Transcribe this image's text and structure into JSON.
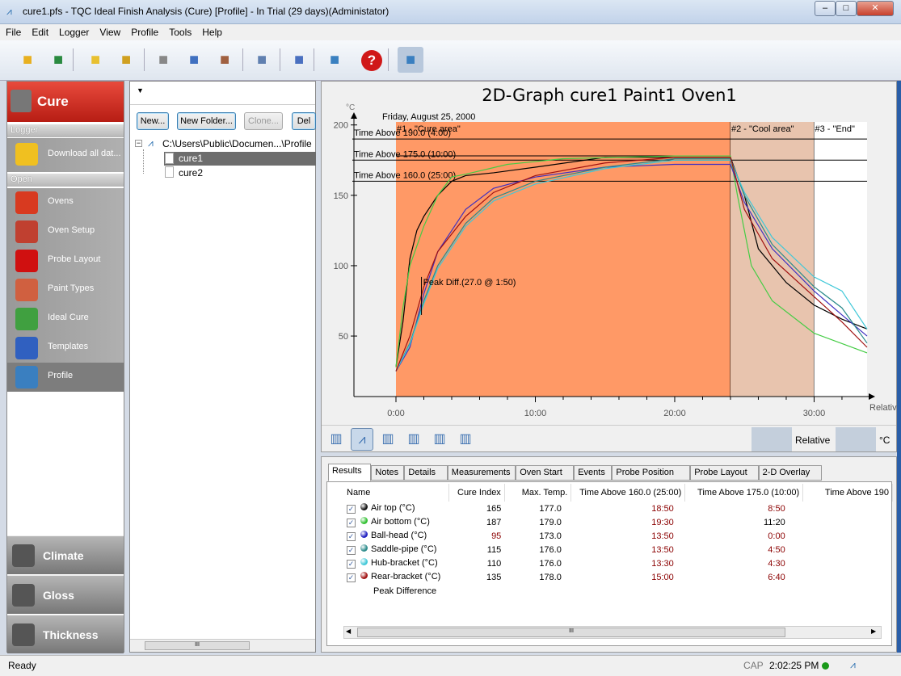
{
  "window": {
    "title": "cure1.pfs - TQC Ideal Finish Analysis (Cure) [Profile]  - In Trial (29 days)(Administator)"
  },
  "menu": [
    "File",
    "Edit",
    "Logger",
    "View",
    "Profile",
    "Tools",
    "Help"
  ],
  "toolbar": [
    "open-folder-icon",
    "export-icon",
    "download-icon",
    "upload-icon",
    "print-icon",
    "print-preview-icon",
    "print-setup-icon",
    "copy-icon",
    "zoom-graph-icon",
    "notes-icon",
    "help-icon",
    "profile-graph-icon"
  ],
  "sidebar": {
    "header": "Cure",
    "logger_label": "Logger",
    "download": "Download all dat...",
    "open_label": "Open",
    "items": [
      {
        "label": "Ovens",
        "color": "#d83a20"
      },
      {
        "label": "Oven Setup",
        "color": "#c04030"
      },
      {
        "label": "Probe Layout",
        "color": "#d01010"
      },
      {
        "label": "Paint Types",
        "color": "#d06040"
      },
      {
        "label": "Ideal Cure",
        "color": "#40a040"
      },
      {
        "label": "Templates",
        "color": "#3060c0"
      },
      {
        "label": "Profile",
        "color": "#3a7fc0"
      }
    ],
    "bottom": [
      "Climate",
      "Gloss",
      "Thickness"
    ]
  },
  "tree": {
    "buttons": [
      "New...",
      "New Folder...",
      "Clone...",
      "Del"
    ],
    "root": "C:\\Users\\Public\\Documen...\\Profile",
    "items": [
      "cure1",
      "cure2"
    ],
    "selected": "cure1",
    "scroll_thumb": "III"
  },
  "graph_toolbar": {
    "icons": [
      "probe-setup-icon",
      "profile-graph-icon",
      "bar-chart-icon",
      "curve-icon",
      "3d-icon",
      "histogram-icon"
    ],
    "mode": "Relative",
    "unit": "°C"
  },
  "chart_data": {
    "type": "line",
    "title": "2D-Graph cure1 Paint1 Oven1",
    "date": "Friday, August 25, 2000",
    "ylabel": "°C",
    "xlabel": "Relative",
    "xlim": [
      0,
      33.8
    ],
    "ylim": [
      7,
      205
    ],
    "xticks": [
      "0:00",
      "10:00",
      "20:00",
      "30:00"
    ],
    "yticks": [
      50,
      100,
      150,
      200
    ],
    "zones": [
      {
        "label": "#1 - \"Cure area\"",
        "from": 0,
        "to": 24,
        "color": "#ff9966"
      },
      {
        "label": "#2 - \"Cool area\"",
        "from": 24,
        "to": 30,
        "color": "#e8c4ae"
      },
      {
        "label": "#3 - \"End\"",
        "from": 30,
        "to": 33.8,
        "color": "#ffffff"
      }
    ],
    "thresholds": [
      {
        "label": "Time Above 190.0 (4:00)",
        "value": 190
      },
      {
        "label": "Time Above 175.0 (10:00)",
        "value": 175
      },
      {
        "label": "Time Above 160.0 (25:00)",
        "value": 160
      }
    ],
    "annotation": {
      "label": "Peak Diff.(27.0 @ 1:50)",
      "x": 1.83,
      "y_low": 65,
      "y_high": 92
    },
    "series": [
      {
        "name": "Air top (°C)",
        "color": "#000000",
        "points": [
          [
            0,
            28
          ],
          [
            0.5,
            60
          ],
          [
            1,
            105
          ],
          [
            1.5,
            125
          ],
          [
            2,
            135
          ],
          [
            3,
            150
          ],
          [
            4,
            160
          ],
          [
            5,
            164
          ],
          [
            7,
            166
          ],
          [
            10,
            170
          ],
          [
            15,
            177
          ],
          [
            20,
            177
          ],
          [
            24,
            177
          ],
          [
            25,
            150
          ],
          [
            26,
            112
          ],
          [
            28,
            88
          ],
          [
            30,
            72
          ],
          [
            32,
            62
          ],
          [
            33.8,
            55
          ]
        ]
      },
      {
        "name": "Air bottom (°C)",
        "color": "#44cc44",
        "points": [
          [
            0,
            28
          ],
          [
            0.5,
            70
          ],
          [
            1,
            100
          ],
          [
            2,
            128
          ],
          [
            3,
            150
          ],
          [
            4,
            163
          ],
          [
            5,
            165
          ],
          [
            8,
            172
          ],
          [
            12,
            176
          ],
          [
            20,
            178
          ],
          [
            24,
            178
          ],
          [
            24.5,
            150
          ],
          [
            25.5,
            100
          ],
          [
            27,
            75
          ],
          [
            30,
            52
          ],
          [
            33.8,
            38
          ]
        ]
      },
      {
        "name": "Ball-head (°C)",
        "color": "#4030c0",
        "points": [
          [
            0,
            25
          ],
          [
            1,
            42
          ],
          [
            2,
            80
          ],
          [
            3,
            110
          ],
          [
            4,
            125
          ],
          [
            5,
            140
          ],
          [
            7,
            155
          ],
          [
            10,
            163
          ],
          [
            15,
            170
          ],
          [
            20,
            172
          ],
          [
            24,
            172
          ],
          [
            25,
            145
          ],
          [
            27,
            112
          ],
          [
            30,
            82
          ],
          [
            32,
            65
          ],
          [
            33.8,
            50
          ]
        ]
      },
      {
        "name": "Saddle-pipe (°C)",
        "color": "#2a8a8a",
        "points": [
          [
            0,
            25
          ],
          [
            1,
            45
          ],
          [
            2,
            75
          ],
          [
            3,
            100
          ],
          [
            5,
            130
          ],
          [
            7,
            148
          ],
          [
            10,
            160
          ],
          [
            15,
            170
          ],
          [
            20,
            176
          ],
          [
            24,
            176
          ],
          [
            25,
            150
          ],
          [
            27,
            115
          ],
          [
            30,
            85
          ],
          [
            32,
            70
          ],
          [
            33.8,
            45
          ]
        ]
      },
      {
        "name": "Hub-bracket (°C)",
        "color": "#40c8d8",
        "points": [
          [
            0,
            25
          ],
          [
            1,
            44
          ],
          [
            2,
            73
          ],
          [
            3,
            98
          ],
          [
            5,
            128
          ],
          [
            7,
            146
          ],
          [
            10,
            158
          ],
          [
            15,
            169
          ],
          [
            20,
            175
          ],
          [
            24,
            175
          ],
          [
            25,
            152
          ],
          [
            27,
            120
          ],
          [
            30,
            92
          ],
          [
            32,
            82
          ],
          [
            33.8,
            55
          ]
        ]
      },
      {
        "name": "Rear-bracket (°C)",
        "color": "#a01010",
        "points": [
          [
            0,
            25
          ],
          [
            1,
            50
          ],
          [
            2,
            85
          ],
          [
            3,
            110
          ],
          [
            5,
            135
          ],
          [
            7,
            152
          ],
          [
            10,
            164
          ],
          [
            15,
            173
          ],
          [
            20,
            177
          ],
          [
            24,
            177
          ],
          [
            25,
            140
          ],
          [
            27,
            105
          ],
          [
            30,
            78
          ],
          [
            32,
            60
          ],
          [
            33.8,
            42
          ]
        ]
      }
    ]
  },
  "results": {
    "tabs": [
      "Results",
      "Notes",
      "Details",
      "Measurements",
      "Oven Start",
      "Events",
      "Probe Position",
      "Probe Layout",
      "2-D Overlay"
    ],
    "columns": [
      "Name",
      "Cure Index",
      "Max. Temp.",
      "Time Above 160.0 (25:00)",
      "Time Above 175.0 (10:00)",
      "Time Above 190"
    ],
    "rows": [
      {
        "name": "Air top (°C)",
        "color": "#111111",
        "ci": "165",
        "max": "177.0",
        "t160": "18:50",
        "t175": "8:50",
        "ci_red": false,
        "t175_red": true
      },
      {
        "name": "Air bottom (°C)",
        "color": "#30c030",
        "ci": "187",
        "max": "179.0",
        "t160": "19:30",
        "t175": "11:20",
        "ci_red": false,
        "t175_red": false
      },
      {
        "name": "Ball-head (°C)",
        "color": "#2020c0",
        "ci": "95",
        "max": "173.0",
        "t160": "13:50",
        "t175": "0:00",
        "ci_red": true,
        "t175_red": true
      },
      {
        "name": "Saddle-pipe (°C)",
        "color": "#2a8a8a",
        "ci": "115",
        "max": "176.0",
        "t160": "13:50",
        "t175": "4:50",
        "ci_red": false,
        "t175_red": true
      },
      {
        "name": "Hub-bracket (°C)",
        "color": "#40c8d8",
        "ci": "110",
        "max": "176.0",
        "t160": "13:30",
        "t175": "4:30",
        "ci_red": false,
        "t175_red": true
      },
      {
        "name": "Rear-bracket (°C)",
        "color": "#a01010",
        "ci": "135",
        "max": "178.0",
        "t160": "15:00",
        "t175": "6:40",
        "ci_red": false,
        "t175_red": true
      }
    ],
    "footer": "Peak Difference",
    "scroll_thumb": "III"
  },
  "status": {
    "text": "Ready",
    "cap": "CAP",
    "time": "2:02:25 PM"
  }
}
